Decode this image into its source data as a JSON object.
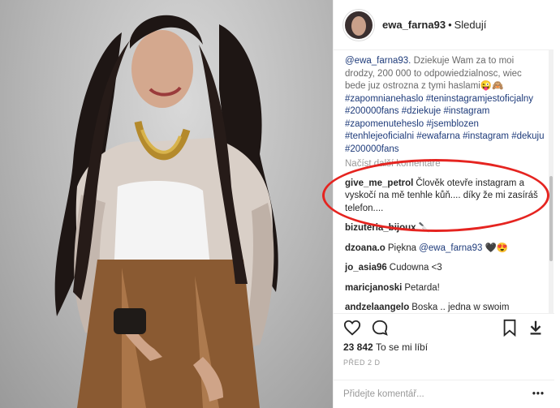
{
  "post": {
    "username": "ewa_farna93",
    "separator": "•",
    "follow": "Sledují"
  },
  "caption": {
    "mention": "@ewa_farna93.",
    "text": " Dziekuje Wam za to moi drodzy, 200 000 to odpowiedzialnosc, wiec bede juz ostrozna z tymi haslami😜🙈",
    "tags": "#zapomnianehaslo #teninstagramjestoficjalny #200000fans #dziekuje #instagram #zapomenuteheslo #jsemblozen #tenhlejeoficialni #ewafarna #instagram #dekuju #200000fans"
  },
  "more_comments": "Načíst další komentáře",
  "comments": [
    {
      "user": "give_me_petrol",
      "text": "Člověk otevře instagram a vyskočí na mě tenhle kůň.... díky že mi zasíráš telefon...."
    },
    {
      "user": "bizuteria_bijoux",
      "text": "🔪"
    },
    {
      "user": "dzoana.o",
      "text": "Piękna ",
      "mention": "@ewa_farna93",
      "after": " 🖤😍"
    },
    {
      "user": "jo_asia96",
      "text": "Cudowna <3"
    },
    {
      "user": "maricjanoski",
      "text": "Petarda!"
    },
    {
      "user": "andzelaangelo",
      "text": "Boska .. jedna w swoim rodzaju.💋🖤"
    }
  ],
  "likes": {
    "count": "23 842",
    "label": "To se mi líbí"
  },
  "date": "PŘED 2 D",
  "add_comment": {
    "placeholder": "Přidejte komentář...",
    "more": "•••"
  },
  "colors": {
    "highlight": "#e52420",
    "link": "#1e3b7a"
  },
  "icons": [
    "heart-icon",
    "comment-icon",
    "bookmark-icon",
    "download-icon",
    "more-icon"
  ]
}
